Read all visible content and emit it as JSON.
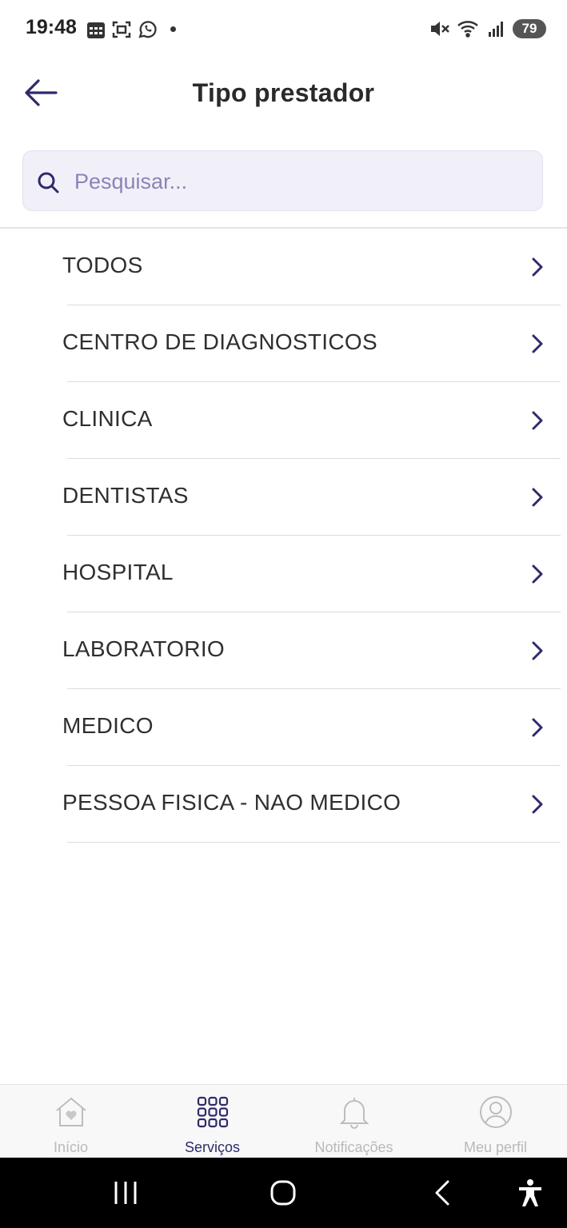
{
  "status_bar": {
    "time": "19:48",
    "battery": "79",
    "icons_left": [
      "calendar-icon",
      "scan-icon",
      "whatsapp-icon",
      "dot"
    ],
    "icons_right": [
      "mute-icon",
      "wifi-icon",
      "signal-icon",
      "battery-icon"
    ]
  },
  "header": {
    "title": "Tipo prestador",
    "back_icon": "arrow-left-icon"
  },
  "search": {
    "placeholder": "Pesquisar...",
    "value": ""
  },
  "list": {
    "items": [
      {
        "label": "TODOS"
      },
      {
        "label": "CENTRO DE DIAGNOSTICOS"
      },
      {
        "label": "CLINICA"
      },
      {
        "label": "DENTISTAS"
      },
      {
        "label": "HOSPITAL"
      },
      {
        "label": "LABORATORIO"
      },
      {
        "label": "MEDICO"
      },
      {
        "label": "PESSOA FISICA - NAO MEDICO"
      }
    ]
  },
  "bottom_nav": {
    "items": [
      {
        "label": "Início",
        "icon": "home-heart-icon",
        "active": false
      },
      {
        "label": "Serviços",
        "icon": "grid-icon",
        "active": true
      },
      {
        "label": "Notificações",
        "icon": "bell-icon",
        "active": false
      },
      {
        "label": "Meu perfil",
        "icon": "user-circle-icon",
        "active": false
      }
    ]
  },
  "colors": {
    "accent": "#2e2a6b",
    "search_bg": "#f1f0f9",
    "placeholder": "#8a84b8",
    "inactive_nav": "#b9b9b9"
  }
}
